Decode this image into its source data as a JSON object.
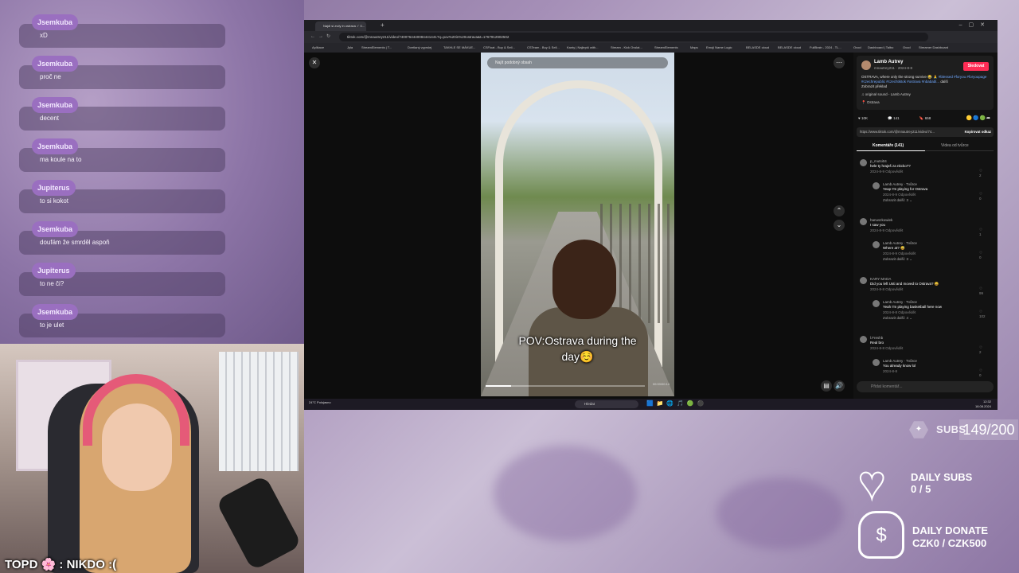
{
  "chat": [
    {
      "user": "Jsemkuba",
      "text": "xD"
    },
    {
      "user": "Jsemkuba",
      "text": "proč ne"
    },
    {
      "user": "Jsemkuba",
      "text": "decent"
    },
    {
      "user": "Jsemkuba",
      "text": "ma koule na to"
    },
    {
      "user": "Jupiterus",
      "text": "to si kokot"
    },
    {
      "user": "Jsemkuba",
      "text": "doufám že smrděl aspoň"
    },
    {
      "user": "Jupiterus",
      "text": "to ne či?"
    },
    {
      "user": "Jsemkuba",
      "text": "to je ulet"
    }
  ],
  "colors": {
    "chat_user_badge": "#9a6fc0",
    "follow_button": "#fe2c55",
    "hashtag": "#6fa8ff"
  },
  "webcam": {
    "topd": "TOPD 🌸 : NIKDO :("
  },
  "browser": {
    "tab_title": "Najdi si zvdy in ostrava ✓ 0...",
    "url": "tiktok.com/@mnautrey211/video/7400764440084441441?q=pov%20in%20ostrava&t=1767912902502",
    "bookmarks": [
      "Aplikace",
      "Jyla",
      "StreamElements | T...",
      "Dvetlaný vyprslej",
      "TAKHLE SE MÁKUE...",
      "CSFloat - Buy & Sell...",
      "CSTeam - Buy & Sell...",
      "Kanty | Najlepší with...",
      "Stream - Kick Ovslat...",
      "StreamElements",
      "Maps",
      "Emoji Name Logic",
      "BELASDE cloud",
      "BELASDE cloud",
      "FullBrain - 2024 - TL...",
      "Ovod",
      "Dashboard | Talbo",
      "Ovod",
      "Streamer Dashboard"
    ],
    "video_search_placeholder": "Najít podobný obsah",
    "caption_line1": "POV:Ostrava during the",
    "caption_line2": "day☺️",
    "video_progress": 0.16,
    "video_time": "00:00/00:14",
    "author": {
      "name": "Lamb Autrey",
      "handle": "mnautrey211 · 2024-8-8",
      "follow": "Sledovat",
      "description_text": "OSTRAVA, where only the strong survive 😂 🙏 ",
      "description_tags": "#blessed #foryou #foryoupage #czechrepublic #czechtiktok #ostrava #nbababl...",
      "more": "další",
      "translate": "Zobrazit překlad",
      "sound": "♫ original sound - Lamb Autrey",
      "location": "Ostrava"
    },
    "stats": {
      "likes": "10K",
      "comments": "141",
      "saves": "658"
    },
    "link": "https://www.tiktok.com/@mnautrey211/video/74...",
    "copy_link": "Kopírovat odkaz",
    "tabs": {
      "comments": "Komentáře (141)",
      "creator_videos": "Videa od tvůrce"
    },
    "comments": [
      {
        "name": "p_mutsi04",
        "text": "hele ty hraješ za nkcko??",
        "meta": "2024-8-9   Odpovědět",
        "likes": "2"
      },
      {
        "name": "Lamb Autrey · Tvůrce",
        "text": "Yeap I'm playing for Ostrava",
        "meta": "2024-8-9   Odpovědět",
        "likes": "0",
        "reply": true,
        "more": "Zobrazit další: 3 ⌄"
      },
      {
        "name": "hanuszkowiek",
        "text": "I saw you",
        "meta": "2024-8-9   Odpovědět",
        "likes": "1"
      },
      {
        "name": "Lamb Autrey · Tvůrce",
        "text": "Where at? 😅",
        "meta": "2024-8-9   Odpovědět",
        "likes": "0",
        "reply": true,
        "more": "Zobrazit další: 3 ⌄"
      },
      {
        "name": "KARY MADA",
        "text": "Did you left Usti and moved to Ostrava? 😄",
        "meta": "2024-8-8   Odpovědět",
        "likes": "99"
      },
      {
        "name": "Lamb Autrey · Tvůrce",
        "text": "Yeah I'm playing basketball here now",
        "meta": "2024-8-8   Odpovědět",
        "likes": "102",
        "reply": true,
        "more": "Zobrazit další: 4 ⌄"
      },
      {
        "name": "l.Freshb",
        "text": "Real bro",
        "meta": "2024-8-8   Odpovědět",
        "likes": "2"
      },
      {
        "name": "Lamb Autrey · Tvůrce",
        "text": "You already know lol",
        "meta": "2024-8-8",
        "likes": "0",
        "reply": true
      }
    ],
    "add_comment": "Přidat komentář..."
  },
  "taskbar": {
    "weather": "24°C Polojasno",
    "search": "Hledat",
    "clock_time": "12:32",
    "clock_date": "18.08.2024"
  },
  "overlay": {
    "subs_label": "SUBS",
    "subs_count": "149/200",
    "daily_subs_title": "DAILY SUBS",
    "daily_subs_value": "0 / 5",
    "daily_donate_title": "DAILY DONATE",
    "daily_donate_value": "CZK0 / CZK500"
  }
}
